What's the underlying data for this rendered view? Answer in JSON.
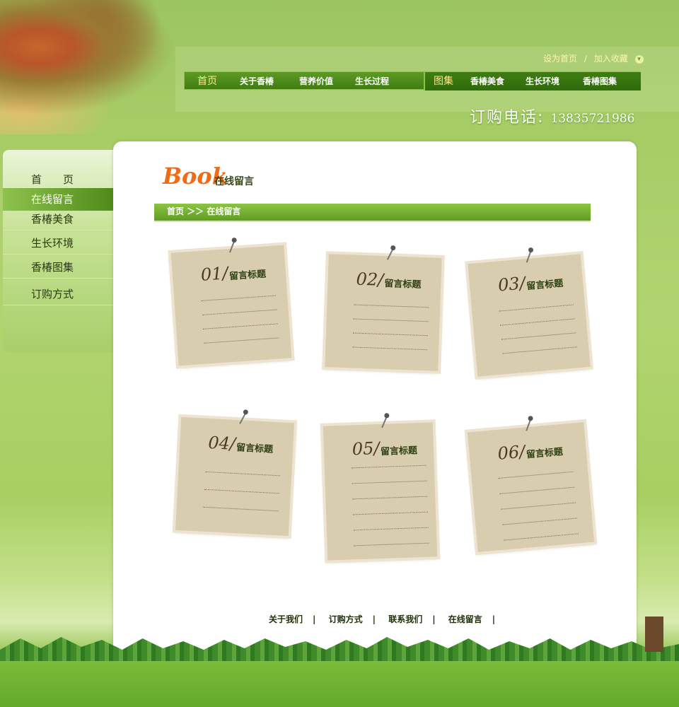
{
  "header": {
    "top_links": [
      "设为首页",
      "/",
      "加入收藏"
    ],
    "nav_left": [
      "首页",
      "关于香椿",
      "营养价值",
      "生长过程"
    ],
    "nav_right": [
      "图集",
      "香椿美食",
      "生长环境",
      "香椿图集"
    ],
    "phone_label": "订购电话:",
    "phone_number": "13835721986"
  },
  "sidebar": {
    "items": [
      "首　　页",
      "在线留言",
      "香椿美食",
      "生长环境",
      "香椿图集",
      "订购方式"
    ],
    "active_index": 1
  },
  "main": {
    "book_word": "Book",
    "book_sub": "在线留言",
    "breadcrumb": "首页 ＞＞ 在线留言",
    "notes": [
      {
        "num": "01/",
        "title": "留言标题"
      },
      {
        "num": "02/",
        "title": "留言标题"
      },
      {
        "num": "03/",
        "title": "留言标题"
      },
      {
        "num": "04/",
        "title": "留言标题"
      },
      {
        "num": "05/",
        "title": "留言标题"
      },
      {
        "num": "06/",
        "title": "留言标题"
      }
    ]
  },
  "footer": {
    "links": [
      "关于我们",
      "订购方式",
      "联系我们",
      "在线留言"
    ],
    "separator": "|"
  },
  "colors": {
    "accent": "#ef6b16",
    "nav_green": "#3f7d12",
    "page_green": "#a6cc66"
  }
}
